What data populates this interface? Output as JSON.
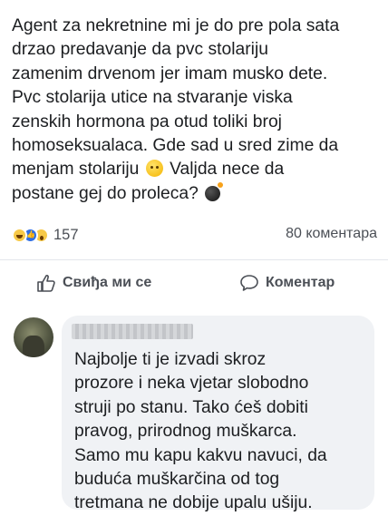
{
  "post": {
    "lines": [
      "Agent za nekretnine mi je do pre pola sata",
      "drzao predavanje da pvc stolariju",
      "zamenim drvenom jer imam musko dete.",
      "Pvc stolarija utice na stvaranje viska",
      "zenskih hormona pa otud toliki broj",
      "homoseksualaca. Gde sad u sred zime da",
      "menjam stolariju",
      "Valjda nece da",
      "postane gej do proleca?"
    ],
    "emoji_1": "confused-face-emoji",
    "emoji_2": "bomb-emoji"
  },
  "reactions": {
    "icons": [
      "haha-reaction-icon",
      "like-reaction-icon",
      "wow-reaction-icon"
    ],
    "count": "157"
  },
  "comments_count": "80 коментара",
  "actions": {
    "like_label": "Свиђа ми се",
    "comment_label": "Коментар"
  },
  "comment": {
    "lines": [
      "Najbolje ti je izvadi skroz",
      "prozore i neka vjetar slobodno",
      "struji po stanu. Tako ćeš dobiti",
      "pravog, prirodnog muškarca.",
      "Samo mu kapu kakvu navuci, da",
      "buduća muškarčina od tog",
      "tretmana ne dobije upalu ušiju."
    ]
  },
  "colors": {
    "text": "#1c1e21",
    "secondary_text": "#4b4f56",
    "comment_bubble": "#f0f2f5",
    "like_blue": "#2f6fe4"
  }
}
